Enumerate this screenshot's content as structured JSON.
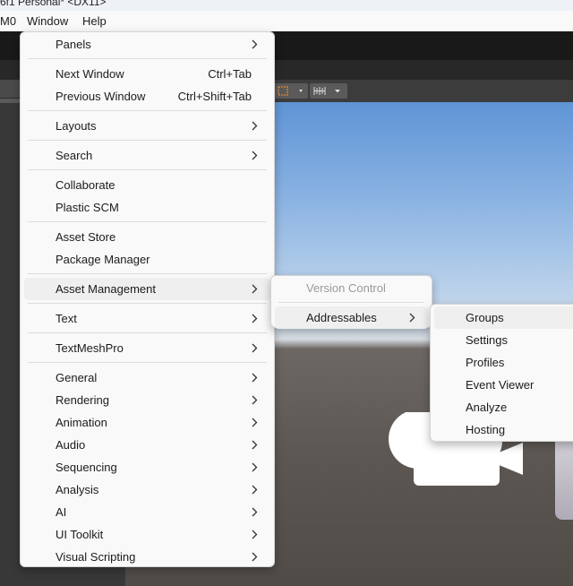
{
  "window_title": "6f1 Personal* <DX11>",
  "menubar": {
    "items": [
      "M0",
      "Window",
      "Help"
    ]
  },
  "window_menu": {
    "groups": [
      [
        {
          "label": "Panels",
          "submenu": true
        }
      ],
      [
        {
          "label": "Next Window",
          "shortcut": "Ctrl+Tab"
        },
        {
          "label": "Previous Window",
          "shortcut": "Ctrl+Shift+Tab"
        }
      ],
      [
        {
          "label": "Layouts",
          "submenu": true
        }
      ],
      [
        {
          "label": "Search",
          "submenu": true
        }
      ],
      [
        {
          "label": "Collaborate"
        },
        {
          "label": "Plastic SCM"
        }
      ],
      [
        {
          "label": "Asset Store"
        },
        {
          "label": "Package Manager"
        }
      ],
      [
        {
          "label": "Asset Management",
          "submenu": true,
          "highlighted": true
        }
      ],
      [
        {
          "label": "Text",
          "submenu": true
        }
      ],
      [
        {
          "label": "TextMeshPro",
          "submenu": true
        }
      ],
      [
        {
          "label": "General",
          "submenu": true
        },
        {
          "label": "Rendering",
          "submenu": true
        },
        {
          "label": "Animation",
          "submenu": true
        },
        {
          "label": "Audio",
          "submenu": true
        },
        {
          "label": "Sequencing",
          "submenu": true
        },
        {
          "label": "Analysis",
          "submenu": true
        },
        {
          "label": "AI",
          "submenu": true
        },
        {
          "label": "UI Toolkit",
          "submenu": true
        },
        {
          "label": "Visual Scripting",
          "submenu": true
        }
      ]
    ]
  },
  "asset_management_menu": {
    "items": [
      {
        "label": "Version Control",
        "disabled": true
      },
      {
        "label": "Addressables",
        "submenu": true,
        "highlighted": true
      }
    ]
  },
  "addressables_menu": {
    "items": [
      {
        "label": "Groups",
        "highlighted": true
      },
      {
        "label": "Settings"
      },
      {
        "label": "Profiles"
      },
      {
        "label": "Event Viewer"
      },
      {
        "label": "Analyze"
      },
      {
        "label": "Hosting"
      }
    ]
  },
  "colors": {
    "menu_bg": "#f9f9f9",
    "highlight": "#efefef",
    "disabled_text": "#9a9a9a"
  }
}
